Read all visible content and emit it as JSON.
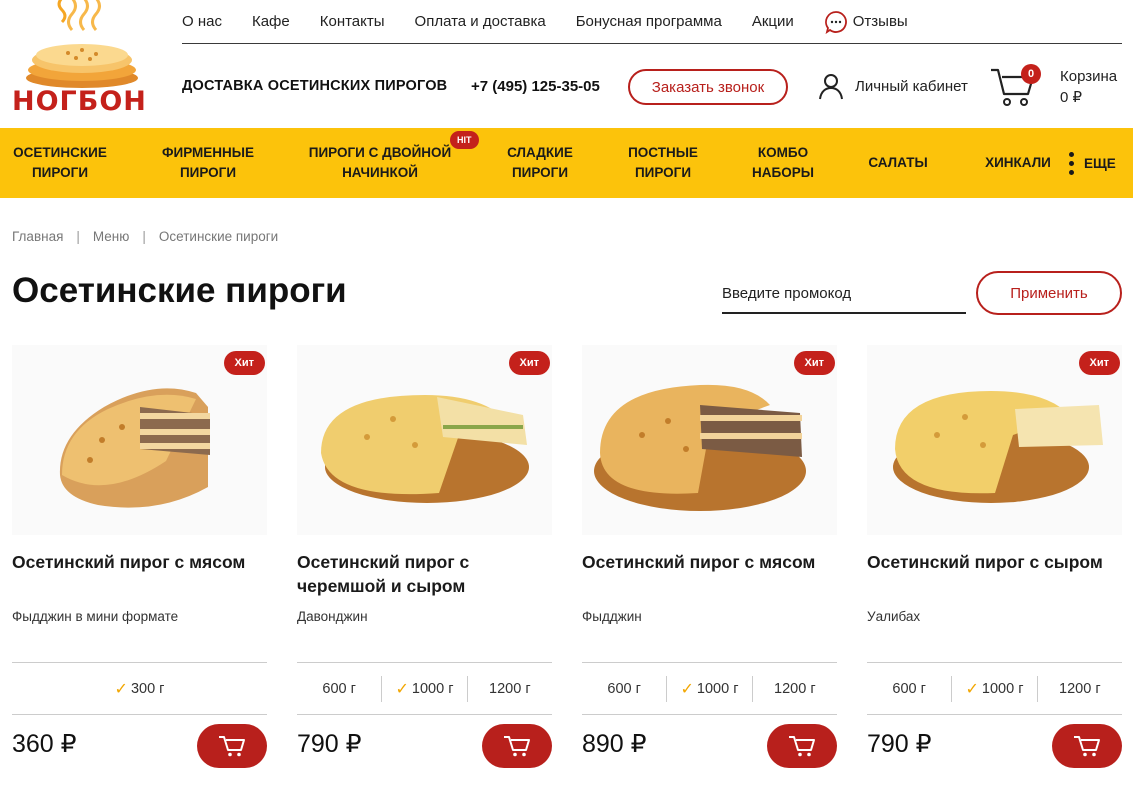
{
  "brand": {
    "logo_text": "НОГБОН"
  },
  "topnav": [
    {
      "label": "О нас"
    },
    {
      "label": "Кафе"
    },
    {
      "label": "Контакты"
    },
    {
      "label": "Оплата и доставка"
    },
    {
      "label": "Бонусная программа"
    },
    {
      "label": "Акции"
    },
    {
      "label": "Отзывы",
      "icon": "chat-bubble-icon"
    }
  ],
  "header": {
    "delivery_title": "ДОСТАВКА ОСЕТИНСКИХ ПИРОГОВ",
    "phone": "+7 (495) 125-35-05",
    "callback_label": "Заказать звонок",
    "account_label": "Личный кабинет",
    "cart_label": "Корзина",
    "cart_total": "0 ₽",
    "cart_count": "0"
  },
  "categories": [
    {
      "label": "ОСЕТИНСКИЕ ПИРОГИ",
      "line1": "ОСЕТИНСКИЕ",
      "line2": "ПИРОГИ"
    },
    {
      "label": "ФИРМЕННЫЕ ПИРОГИ",
      "line1": "ФИРМЕННЫЕ",
      "line2": "ПИРОГИ"
    },
    {
      "label": "ПИРОГИ С ДВОЙНОЙ НАЧИНКОЙ",
      "line1": "ПИРОГИ С ДВОЙНОЙ",
      "line2": "НАЧИНКОЙ",
      "badge": "HIT"
    },
    {
      "label": "СЛАДКИЕ ПИРОГИ",
      "line1": "СЛАДКИЕ",
      "line2": "ПИРОГИ"
    },
    {
      "label": "ПОСТНЫЕ ПИРОГИ",
      "line1": "ПОСТНЫЕ",
      "line2": "ПИРОГИ"
    },
    {
      "label": "КОМБО НАБОРЫ",
      "line1": "КОМБО",
      "line2": "НАБОРЫ"
    },
    {
      "label": "САЛАТЫ",
      "line1": "САЛАТЫ",
      "line2": ""
    },
    {
      "label": "ХИНКАЛИ",
      "line1": "ХИНКАЛИ",
      "line2": ""
    }
  ],
  "more_label": "ЕЩЕ",
  "breadcrumbs": [
    "Главная",
    "Меню",
    "Осетинские пироги"
  ],
  "page_title": "Осетинские пироги",
  "promo": {
    "placeholder": "Введите промокод",
    "apply_label": "Применить"
  },
  "colors": {
    "accent_red": "#b8201c",
    "category_bar": "#fcc30b",
    "check": "#f2a600"
  },
  "products": [
    {
      "badge": "Хит",
      "title": "Осетинский пирог с мясом",
      "subtitle": "Фыдджин в мини формате",
      "weights": [
        {
          "label": "300 г",
          "selected": true
        }
      ],
      "price": "360 ₽"
    },
    {
      "badge": "Хит",
      "title": "Осетинский пирог с черемшой и сыром",
      "subtitle": "Давонджин",
      "weights": [
        {
          "label": "600 г",
          "selected": false
        },
        {
          "label": "1000 г",
          "selected": true
        },
        {
          "label": "1200 г",
          "selected": false
        }
      ],
      "price": "790 ₽"
    },
    {
      "badge": "Хит",
      "title": "Осетинский пирог с мясом",
      "subtitle": "Фыдджин",
      "weights": [
        {
          "label": "600 г",
          "selected": false
        },
        {
          "label": "1000 г",
          "selected": true
        },
        {
          "label": "1200 г",
          "selected": false
        }
      ],
      "price": "890 ₽"
    },
    {
      "badge": "Хит",
      "title": "Осетинский пирог с сыром",
      "subtitle": "Уалибах",
      "weights": [
        {
          "label": "600 г",
          "selected": false
        },
        {
          "label": "1000 г",
          "selected": true
        },
        {
          "label": "1200 г",
          "selected": false
        }
      ],
      "price": "790 ₽"
    }
  ]
}
